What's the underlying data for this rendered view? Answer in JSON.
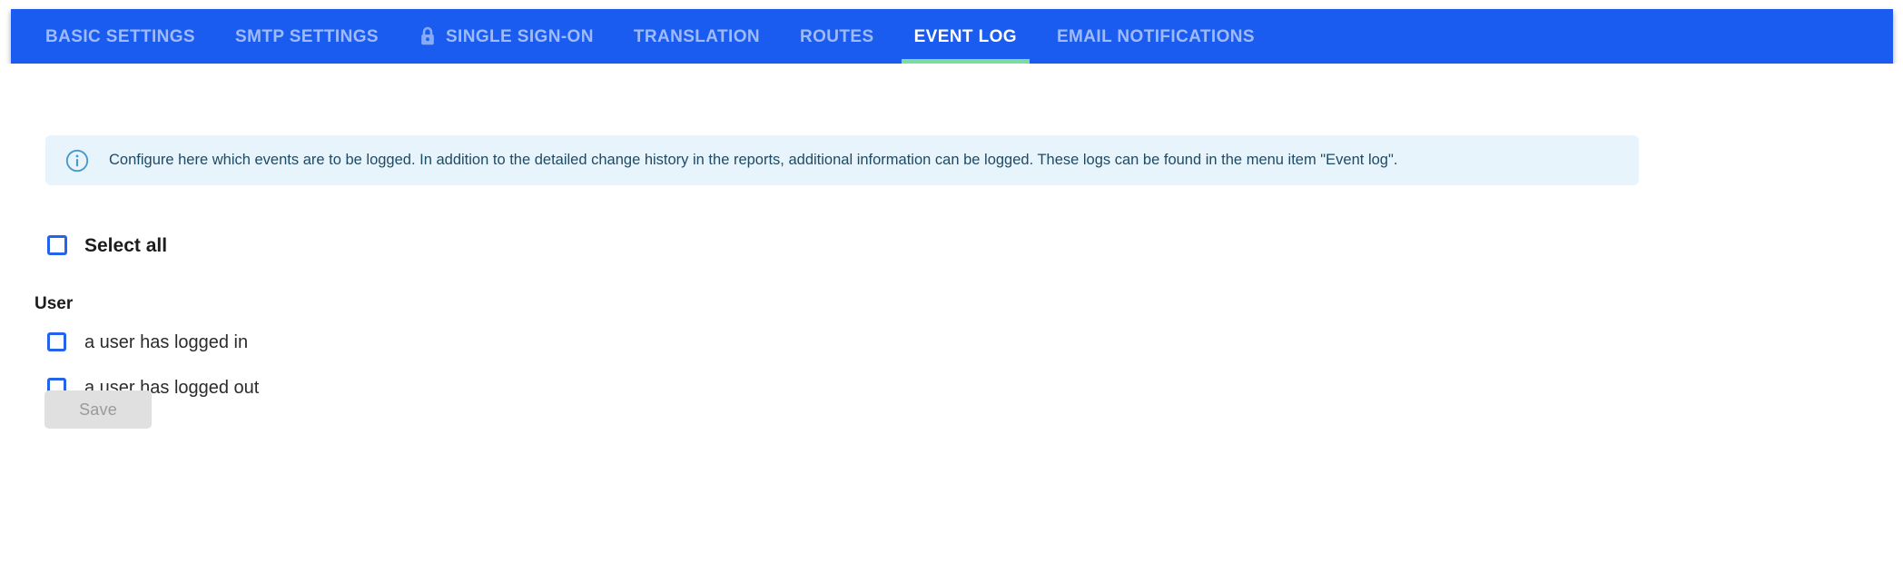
{
  "navbar": {
    "tabs": [
      {
        "label": "BASIC SETTINGS",
        "active": false,
        "icon": null
      },
      {
        "label": "SMTP SETTINGS",
        "active": false,
        "icon": null
      },
      {
        "label": "SINGLE SIGN-ON",
        "active": false,
        "icon": "lock-icon"
      },
      {
        "label": "TRANSLATION",
        "active": false,
        "icon": null
      },
      {
        "label": "ROUTES",
        "active": false,
        "icon": null
      },
      {
        "label": "EVENT LOG",
        "active": true,
        "icon": null
      },
      {
        "label": "EMAIL NOTIFICATIONS",
        "active": false,
        "icon": null
      }
    ],
    "background_color": "#1A5CF0",
    "active_underline_color": "#7BDCA0",
    "active_text_color": "#FFFFFF",
    "inactive_text_color": "rgba(255,255,255,0.58)"
  },
  "banner": {
    "icon": "info-circle-icon",
    "text": "Configure here which events are to be logged. In addition to the detailed change history in the reports, additional information can be logged. These logs can be found in the menu item \"Event log\".",
    "background_color": "#E8F4FB",
    "text_color": "#1F4A63",
    "icon_color": "#4A9AC9"
  },
  "form": {
    "select_all": {
      "label": "Select all",
      "checked": false
    },
    "groups": [
      {
        "heading": "User",
        "options": [
          {
            "label": "a user has logged in",
            "checked": false
          },
          {
            "label": "a user has logged out",
            "checked": false
          }
        ]
      }
    ],
    "checkbox_border_color": "#2563EB"
  },
  "actions": {
    "save_label": "Save",
    "save_disabled": true,
    "save_background_color": "#E0E0E0",
    "save_text_color": "#9A9A9A"
  }
}
